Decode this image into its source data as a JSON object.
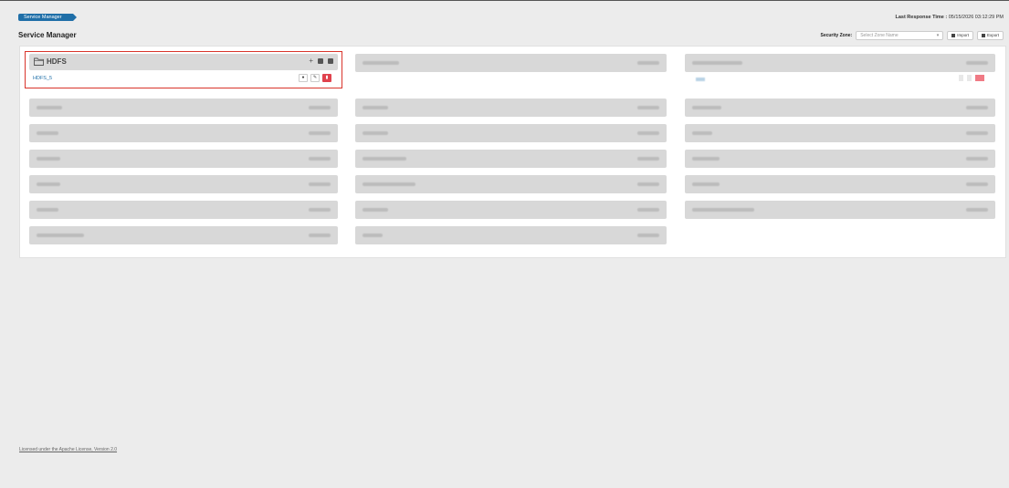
{
  "breadcrumb": {
    "label": "Service Manager"
  },
  "header": {
    "last_response_label": "Last Response Time :",
    "last_response_value": "05/15/2026 03:12:29 PM",
    "page_title": "Service Manager",
    "security_zone_label": "Security Zone:",
    "security_zone_placeholder": "Select Zone Name",
    "import_label": "Import",
    "export_label": "Export"
  },
  "hdfs": {
    "title": "HDFS",
    "service_link": "HDFS_5",
    "add_icon": "plus-icon",
    "import_icon": "import-icon",
    "export_icon": "export-icon",
    "view_icon": "eye-icon",
    "edit_icon": "edit-icon",
    "delete_icon": "trash-icon"
  },
  "footer": {
    "license": "Licensed under the Apache License, Version 2.0"
  },
  "colors": {
    "accent": "#1f6fa8",
    "danger": "#e0424d",
    "highlight": "#d9342b"
  }
}
